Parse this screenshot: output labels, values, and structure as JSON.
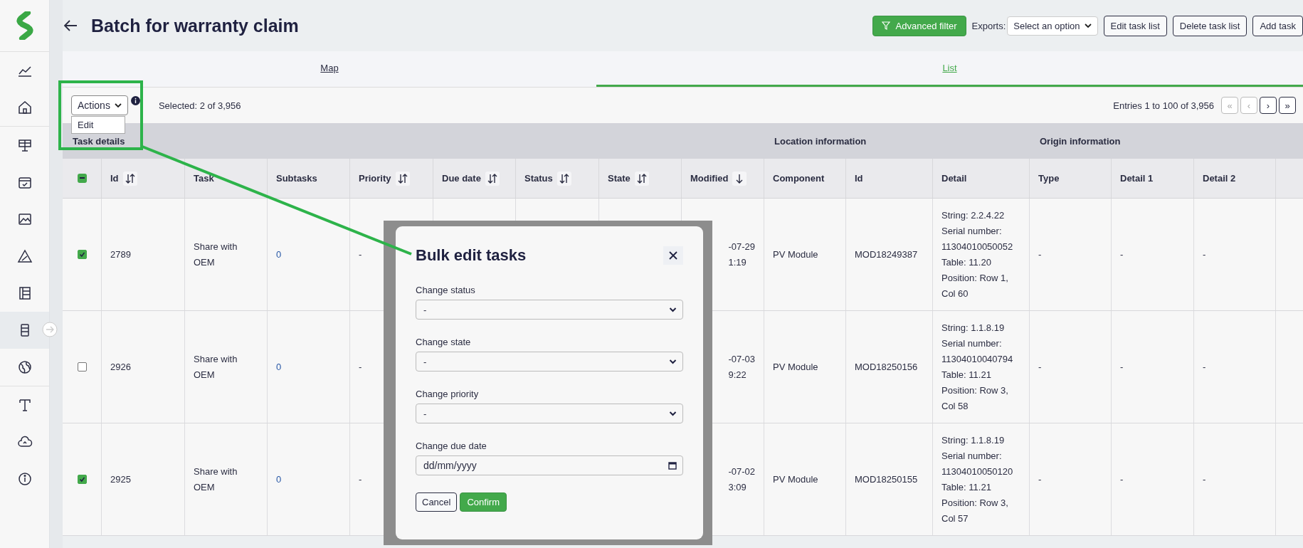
{
  "sidebar": {
    "items": [
      {
        "selected": false
      },
      {
        "selected": false
      },
      {
        "selected": false
      },
      {
        "selected": false
      },
      {
        "selected": false
      },
      {
        "selected": false
      },
      {
        "selected": false
      },
      {
        "selected": true
      },
      {
        "selected": false
      },
      {
        "selected": false
      },
      {
        "selected": false
      },
      {
        "selected": false
      }
    ]
  },
  "header": {
    "title": "Batch for warranty claim",
    "advanced_filter": "Advanced filter",
    "exports_label": "Exports:",
    "exports_select": "Select an option",
    "buttons": [
      "Edit task list",
      "Delete task list",
      "Add task"
    ]
  },
  "tabs": [
    {
      "label": "Map",
      "selected": false
    },
    {
      "label": "List",
      "selected": true
    }
  ],
  "toolbar": {
    "actions": "Actions",
    "actions_menu": {
      "expanded": true,
      "items": [
        "Edit"
      ]
    },
    "selected_text": "Selected: 2 of 3,956",
    "entries_text": "Entries 1 to 100 of 3,956",
    "pagination": [
      {
        "label": "«",
        "disabled": true
      },
      {
        "label": "‹",
        "disabled": true
      },
      {
        "label": "›",
        "disabled": false
      },
      {
        "label": "»",
        "disabled": false
      }
    ]
  },
  "table": {
    "group_headers": [
      "Task details",
      "Location information",
      "Origin information"
    ],
    "header_checkbox": {
      "indeterminate": true
    },
    "columns": [
      {
        "label": "Id",
        "kind": "sortable"
      },
      {
        "label": "Task",
        "kind": "plain"
      },
      {
        "label": "Subtasks",
        "kind": "plain"
      },
      {
        "label": "Priority",
        "kind": "sortable"
      },
      {
        "label": "Due date",
        "kind": "sortable"
      },
      {
        "label": "Status",
        "kind": "sortable"
      },
      {
        "label": "State",
        "kind": "sortable"
      },
      {
        "label": "Modified",
        "kind": "sorted"
      },
      {
        "label": "Component",
        "kind": "plain"
      },
      {
        "label": "Id",
        "kind": "plain"
      },
      {
        "label": "Detail",
        "kind": "plain"
      },
      {
        "label": "Type",
        "kind": "plain"
      },
      {
        "label": "Detail 1",
        "kind": "plain"
      },
      {
        "label": "Detail 2",
        "kind": "plain"
      }
    ],
    "rows": [
      {
        "checked": true,
        "id": "2789",
        "task": "Share with OEM",
        "subtasks": "0",
        "priority": "-",
        "modified": [
          "-07-29",
          "1:19"
        ],
        "component": "PV Module",
        "component_id": "MOD18249387",
        "detail": [
          "String: 2.2.4.22",
          "Serial number:",
          "11304010050052",
          "Table: 11.20",
          "Position: Row 1,",
          "Col 60"
        ],
        "type": "-",
        "detail_1": "-",
        "detail_2": "-"
      },
      {
        "checked": false,
        "id": "2926",
        "task": "Share with OEM",
        "subtasks": "0",
        "priority": "-",
        "modified": [
          "-07-03",
          "9:22"
        ],
        "component": "PV Module",
        "component_id": "MOD18250156",
        "detail": [
          "String: 1.1.8.19",
          "Serial number:",
          "11304010040794",
          "Table: 11.21",
          "Position: Row 3,",
          "Col 58"
        ],
        "type": "-",
        "detail_1": "-",
        "detail_2": "-"
      },
      {
        "checked": true,
        "id": "2925",
        "task": "Share with OEM",
        "subtasks": "0",
        "priority": "-",
        "modified": [
          "-07-02",
          "3:09"
        ],
        "component": "PV Module",
        "component_id": "MOD18250155",
        "detail": [
          "String: 1.1.8.19",
          "Serial number:",
          "11304010050120",
          "Table: 11.21",
          "Position: Row 3,",
          "Col 57"
        ],
        "type": "-",
        "detail_1": "-",
        "detail_2": "-"
      }
    ]
  },
  "modal": {
    "title": "Bulk edit tasks",
    "fields": [
      {
        "kind": "select",
        "label": "Change status",
        "value": "-"
      },
      {
        "kind": "select",
        "label": "Change state",
        "value": "-"
      },
      {
        "kind": "select",
        "label": "Change priority",
        "value": "-"
      },
      {
        "kind": "date",
        "label": "Change due date",
        "placeholder": "dd/mm/yyyy"
      }
    ],
    "cancel": "Cancel",
    "confirm": "Confirm"
  }
}
